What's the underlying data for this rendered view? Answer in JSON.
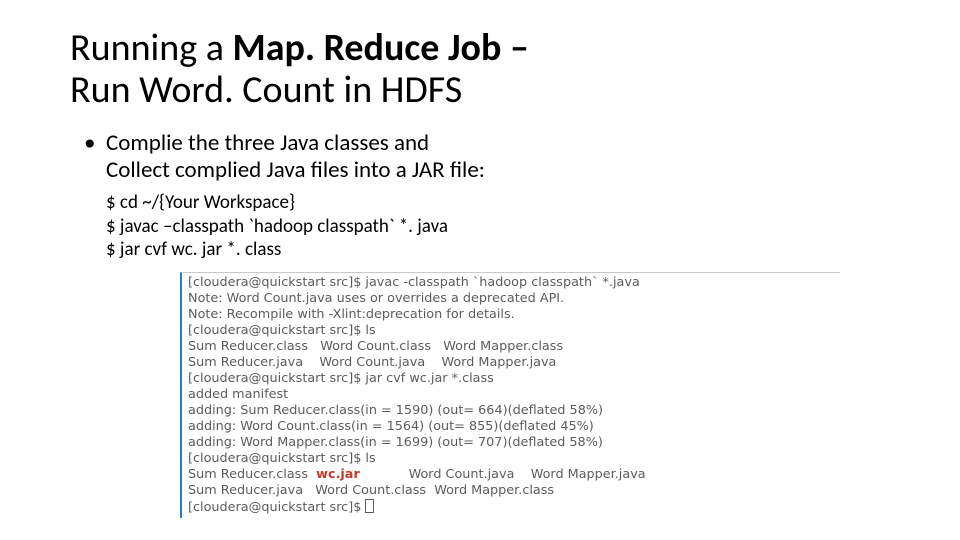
{
  "title": {
    "part1": "Running a ",
    "bold": "Map. Reduce Job –",
    "part2": "Run Word. Count in HDFS"
  },
  "bullet": {
    "l1": "Complie the three Java classes and",
    "l2": "Collect complied Java files into a JAR file:"
  },
  "cmds": {
    "l1": "$ cd ~/{Your Workspace}",
    "l2": "$ javac –classpath `hadoop classpath` *. java",
    "l3": "$ jar cvf wc. jar *. class"
  },
  "term": {
    "l1": "[cloudera@quickstart src]$ javac -classpath `hadoop classpath` *.java",
    "l2": "Note: Word Count.java uses or overrides a deprecated API.",
    "l3": "Note: Recompile with -Xlint:deprecation for details.",
    "l4": "[cloudera@quickstart src]$ ls",
    "l5": "Sum Reducer.class   Word Count.class   Word Mapper.class",
    "l6": "Sum Reducer.java    Word Count.java    Word Mapper.java",
    "l7": "[cloudera@quickstart src]$ jar cvf wc.jar *.class",
    "l8": "added manifest",
    "l9": "adding: Sum Reducer.class(in = 1590) (out= 664)(deflated 58%)",
    "l10": "adding: Word Count.class(in = 1564) (out= 855)(deflated 45%)",
    "l11": "adding: Word Mapper.class(in = 1699) (out= 707)(deflated 58%)",
    "l12": "[cloudera@quickstart src]$ ls",
    "l13a": "Sum Reducer.class  ",
    "l13b": "wc.jar",
    "l13c": "            Word Count.java    Word Mapper.java",
    "l14": "Sum Reducer.java   Word Count.class  Word Mapper.class",
    "l15": "[cloudera@quickstart src]$ "
  }
}
